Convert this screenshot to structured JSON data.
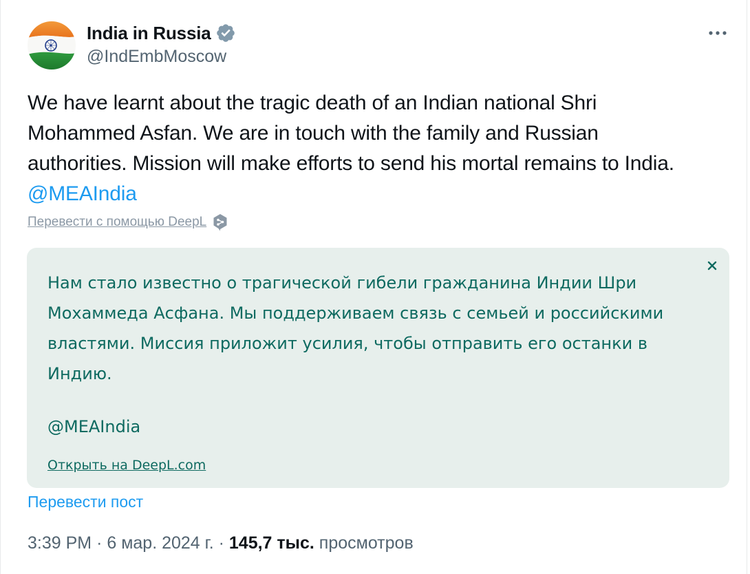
{
  "account": {
    "display_name": "India in Russia",
    "handle": "@IndEmbMoscow",
    "verified_icon": "verified-badge-icon"
  },
  "tweet": {
    "text_line1": "We have learnt about the tragic death of an Indian national Shri",
    "text_line2": "Mohammed Asfan. We are in touch with the family and Russian",
    "text_line3": "authorities. Mission will make efforts to send his mortal remains to India.",
    "mention": "@MEAIndia"
  },
  "deepl": {
    "translate_link": "Перевести с помощью DeepL",
    "translation_line1": "Нам стало известно о трагической гибели гражданина Индии Шри",
    "translation_line2": "Мохаммеда Асфана. Мы поддерживаем связь с семьей и российскими",
    "translation_line3": "властями. Миссия приложит усилия, чтобы отправить его останки в",
    "translation_line4": "Индию.",
    "translation_mention": "@MEAIndia",
    "open_link": "Открыть на DeepL.com"
  },
  "actions": {
    "translate_post": "Перевести пост"
  },
  "meta": {
    "time": "3:39 PM",
    "separator": "·",
    "date": "6 мар. 2024 г.",
    "views_count": "145,7 тыс.",
    "views_label": "просмотров"
  },
  "colors": {
    "link_blue": "#1d9bf0",
    "text_primary": "#0f1419",
    "text_secondary": "#536471",
    "translation_bg": "#e7efec",
    "translation_text": "#0e6a60"
  }
}
